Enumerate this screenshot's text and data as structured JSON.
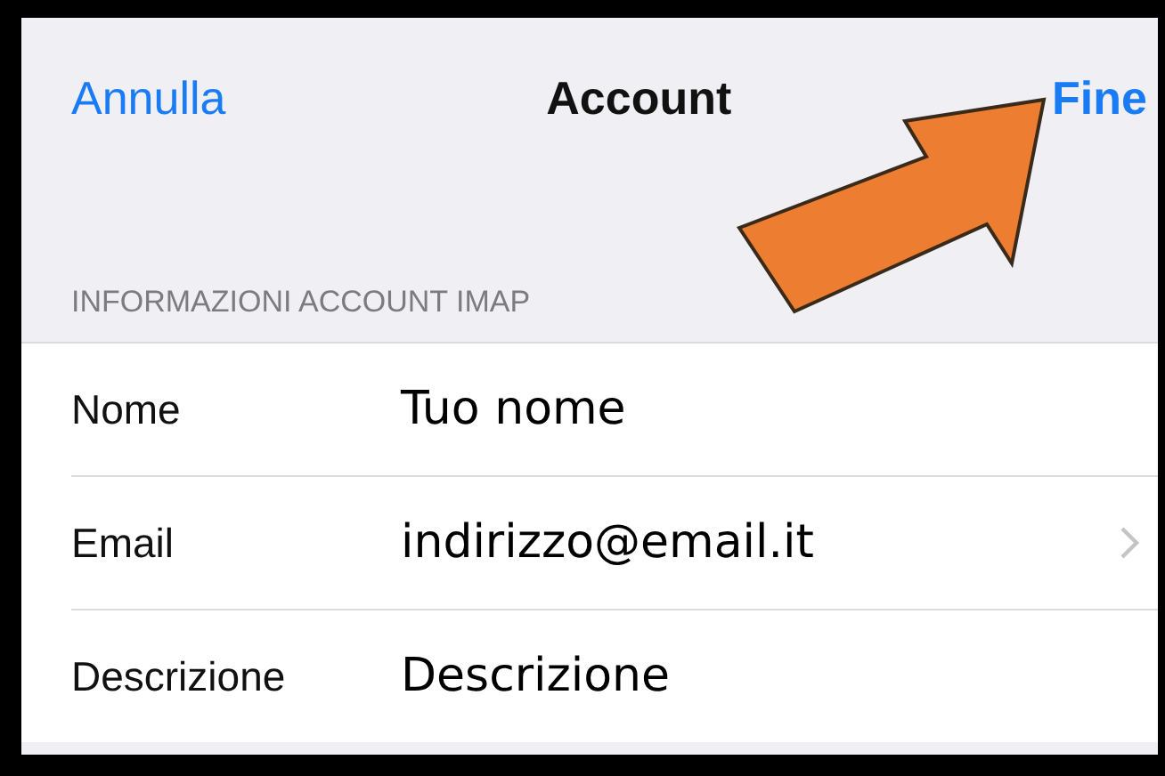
{
  "nav": {
    "cancel": "Annulla",
    "title": "Account",
    "done": "Fine"
  },
  "section_header": "INFORMAZIONI ACCOUNT IMAP",
  "rows": [
    {
      "label": "Nome",
      "value": "Tuo nome",
      "chevron": false
    },
    {
      "label": "Email",
      "value": "indirizzo@email.it",
      "chevron": true
    },
    {
      "label": "Descrizione",
      "value": "Descrizione",
      "chevron": false
    }
  ]
}
